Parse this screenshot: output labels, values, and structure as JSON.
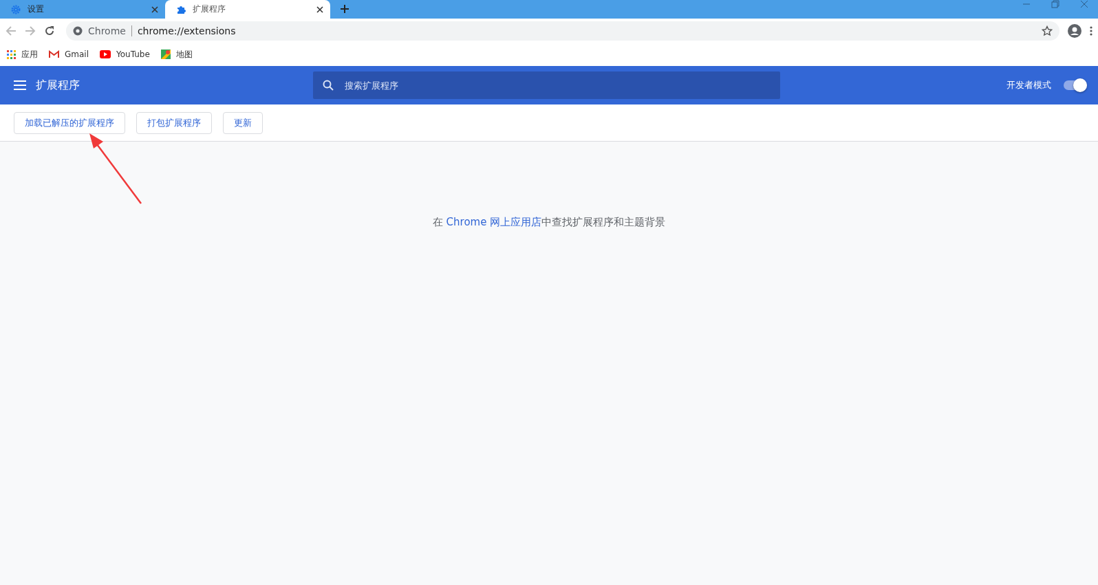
{
  "tabs": [
    {
      "title": "设置",
      "selected": false
    },
    {
      "title": "扩展程序",
      "selected": true
    }
  ],
  "address_bar": {
    "site_label": "Chrome",
    "url": "chrome://extensions"
  },
  "bookmarks": [
    {
      "label": "应用"
    },
    {
      "label": "Gmail"
    },
    {
      "label": "YouTube"
    },
    {
      "label": "地图"
    }
  ],
  "header": {
    "title": "扩展程序",
    "search": {
      "placeholder": "搜索扩展程序"
    },
    "developer_mode": {
      "label": "开发者模式",
      "on": true
    }
  },
  "actions": [
    "加载已解压的扩展程序",
    "打包扩展程序",
    "更新"
  ],
  "empty_state": {
    "before": "在 ",
    "link": "Chrome 网上应用店",
    "after": "中查找扩展程序和主题背景"
  }
}
